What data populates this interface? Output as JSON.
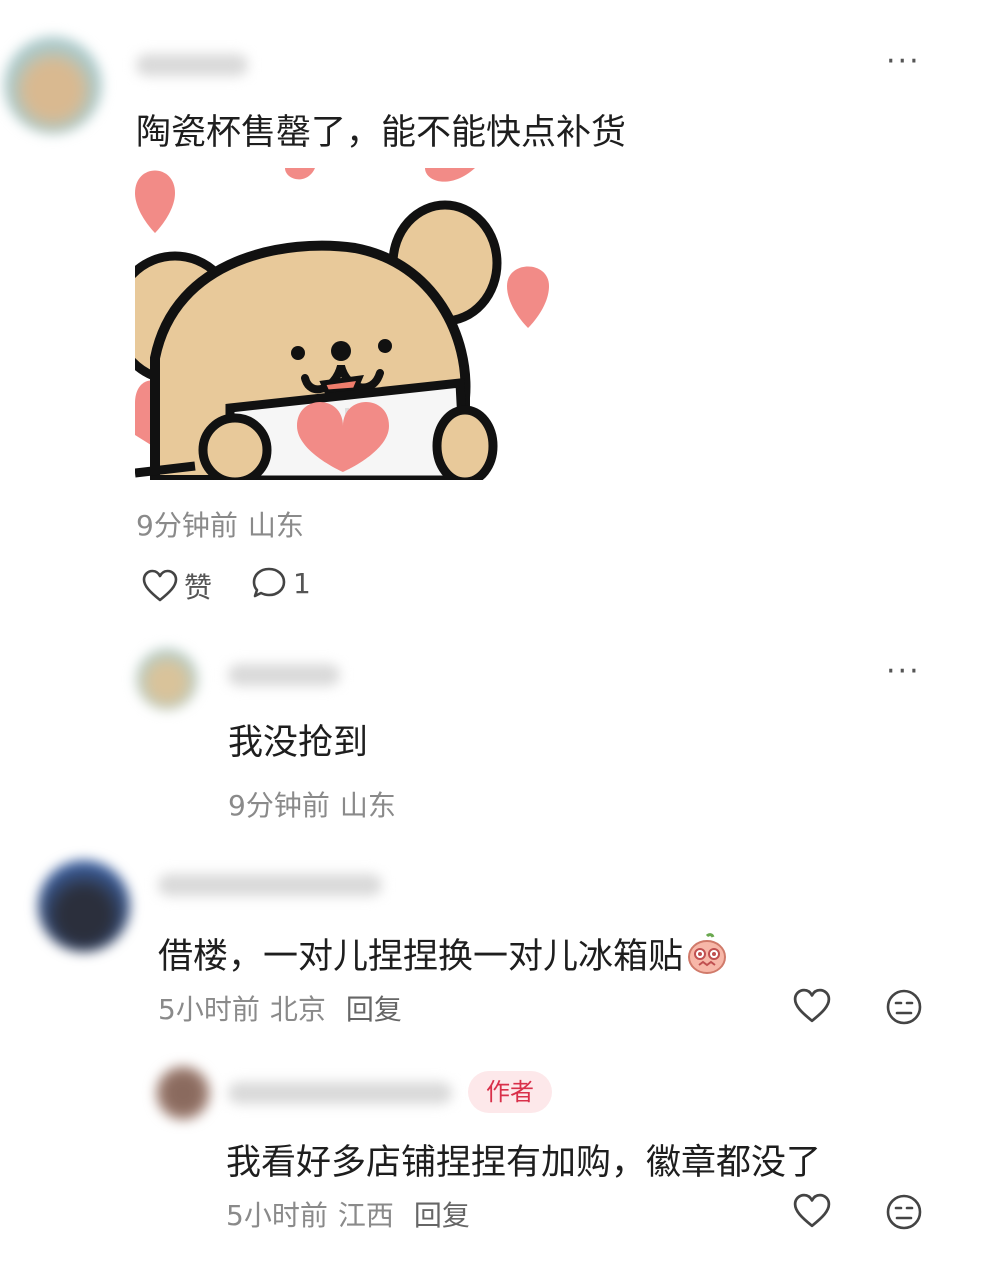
{
  "comment1": {
    "text": "陶瓷杯售罄了，能不能快点补货",
    "time": "9分钟前",
    "location": "山东",
    "like_label": "赞",
    "reply_count": "1",
    "more": "···"
  },
  "reply1": {
    "text": "我没抢到",
    "time": "9分钟前",
    "location": "山东",
    "more": "···"
  },
  "comment2": {
    "text": "借楼，一对儿捏捏换一对儿冰箱贴",
    "time": "5小时前",
    "location": "北京",
    "reply_label": "回复"
  },
  "reply2": {
    "author_tag": "作者",
    "text": "我看好多店铺捏捏有加购，徽章都没了",
    "time": "5小时前",
    "location": "江西",
    "reply_label": "回复"
  },
  "colors": {
    "author_tag_bg": "#fde8ea",
    "author_tag_text": "#d9304a",
    "meta_text": "#8a8a8a",
    "sticker_bear": "#e8c99a",
    "sticker_heart": "#f28b87"
  }
}
